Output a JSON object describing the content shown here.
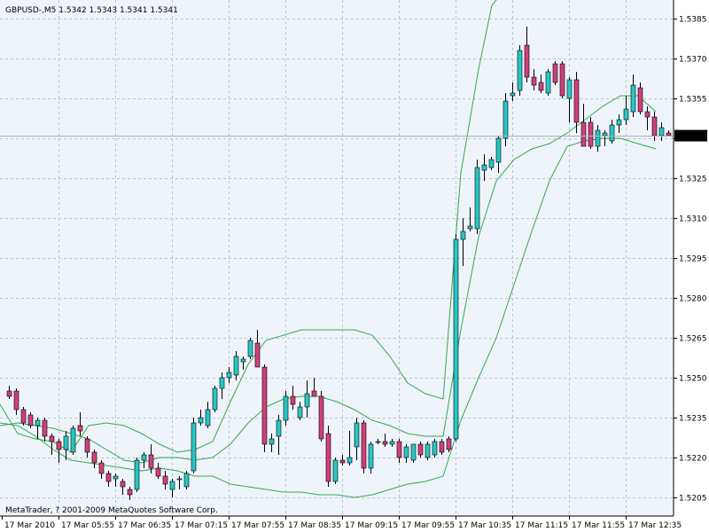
{
  "header": {
    "symbol_label": "GBPUSD-,M5  1.5342 1.5343 1.5341 1.5341"
  },
  "footer": {
    "copyright": "MetaTrader, ? 2001-2009 MetaQuotes Software Corp."
  },
  "colors": {
    "background": "#eef4fa",
    "grid": "#b9c4cf",
    "bull_body": "#28c6c6",
    "bear_body": "#d0407a",
    "band": "#37a84e",
    "price_line": "#a9b4bf",
    "price_tag_bg": "#000000",
    "price_tag_text": "#ffffff"
  },
  "chart_data": {
    "type": "candlestick",
    "title": "",
    "ylim": [
      1.5198,
      1.5392
    ],
    "y_ticks": [
      "1.5385",
      "1.5370",
      "1.5355",
      "1.5340",
      "1.5325",
      "1.5310",
      "1.5295",
      "1.5280",
      "1.5265",
      "1.5250",
      "1.5235",
      "1.5220",
      "1.5205"
    ],
    "current_price": "1.5341",
    "x_ticks": [
      "17 Mar 2010",
      "17 Mar 05:55",
      "17 Mar 06:35",
      "17 Mar 07:15",
      "17 Mar 07:55",
      "17 Mar 08:35",
      "17 Mar 09:15",
      "17 Mar 09:55",
      "17 Mar 10:35",
      "17 Mar 11:15",
      "17 Mar 11:55",
      "17 Mar 12:35"
    ],
    "candles": [
      {
        "o": 1.5245,
        "h": 1.5247,
        "l": 1.5242,
        "c": 1.5243
      },
      {
        "o": 1.5245,
        "h": 1.5246,
        "l": 1.5236,
        "c": 1.5238
      },
      {
        "o": 1.5238,
        "h": 1.5239,
        "l": 1.5232,
        "c": 1.5233
      },
      {
        "o": 1.5236,
        "h": 1.5237,
        "l": 1.5231,
        "c": 1.5232
      },
      {
        "o": 1.5232,
        "h": 1.5235,
        "l": 1.5227,
        "c": 1.5234
      },
      {
        "o": 1.5234,
        "h": 1.5235,
        "l": 1.5226,
        "c": 1.5228
      },
      {
        "o": 1.5228,
        "h": 1.5229,
        "l": 1.5221,
        "c": 1.5226
      },
      {
        "o": 1.5226,
        "h": 1.5227,
        "l": 1.5218,
        "c": 1.5223
      },
      {
        "o": 1.5223,
        "h": 1.523,
        "l": 1.5219,
        "c": 1.5228
      },
      {
        "o": 1.5222,
        "h": 1.5232,
        "l": 1.5221,
        "c": 1.5231
      },
      {
        "o": 1.5232,
        "h": 1.5237,
        "l": 1.5228,
        "c": 1.523
      },
      {
        "o": 1.5227,
        "h": 1.5228,
        "l": 1.522,
        "c": 1.5222
      },
      {
        "o": 1.5222,
        "h": 1.5223,
        "l": 1.5216,
        "c": 1.5218
      },
      {
        "o": 1.5218,
        "h": 1.5219,
        "l": 1.5212,
        "c": 1.5214
      },
      {
        "o": 1.5214,
        "h": 1.5215,
        "l": 1.5209,
        "c": 1.5211
      },
      {
        "o": 1.5212,
        "h": 1.5214,
        "l": 1.5209,
        "c": 1.5213
      },
      {
        "o": 1.5211,
        "h": 1.5212,
        "l": 1.5206,
        "c": 1.5209
      },
      {
        "o": 1.5208,
        "h": 1.5209,
        "l": 1.5204,
        "c": 1.5206
      },
      {
        "o": 1.5208,
        "h": 1.522,
        "l": 1.5207,
        "c": 1.5219
      },
      {
        "o": 1.5219,
        "h": 1.5222,
        "l": 1.5216,
        "c": 1.5221
      },
      {
        "o": 1.5221,
        "h": 1.5225,
        "l": 1.5214,
        "c": 1.5216
      },
      {
        "o": 1.5216,
        "h": 1.5218,
        "l": 1.5212,
        "c": 1.5213
      },
      {
        "o": 1.5213,
        "h": 1.5215,
        "l": 1.5208,
        "c": 1.521
      },
      {
        "o": 1.5208,
        "h": 1.5212,
        "l": 1.5205,
        "c": 1.5211
      },
      {
        "o": 1.5212,
        "h": 1.5213,
        "l": 1.5208,
        "c": 1.5212
      },
      {
        "o": 1.5209,
        "h": 1.5215,
        "l": 1.5208,
        "c": 1.5214
      },
      {
        "o": 1.5215,
        "h": 1.5235,
        "l": 1.5214,
        "c": 1.5233
      },
      {
        "o": 1.5233,
        "h": 1.5238,
        "l": 1.5232,
        "c": 1.5235
      },
      {
        "o": 1.5232,
        "h": 1.5241,
        "l": 1.5231,
        "c": 1.5238
      },
      {
        "o": 1.5238,
        "h": 1.5247,
        "l": 1.5237,
        "c": 1.5246
      },
      {
        "o": 1.5246,
        "h": 1.5252,
        "l": 1.5242,
        "c": 1.525
      },
      {
        "o": 1.525,
        "h": 1.5254,
        "l": 1.5248,
        "c": 1.5252
      },
      {
        "o": 1.5251,
        "h": 1.526,
        "l": 1.5249,
        "c": 1.5258
      },
      {
        "o": 1.5256,
        "h": 1.5258,
        "l": 1.5253,
        "c": 1.5257
      },
      {
        "o": 1.5258,
        "h": 1.5265,
        "l": 1.5257,
        "c": 1.5264
      },
      {
        "o": 1.5263,
        "h": 1.5268,
        "l": 1.5254,
        "c": 1.5254
      },
      {
        "o": 1.5254,
        "h": 1.5255,
        "l": 1.5222,
        "c": 1.5225
      },
      {
        "o": 1.5225,
        "h": 1.5229,
        "l": 1.5222,
        "c": 1.5227
      },
      {
        "o": 1.5228,
        "h": 1.5236,
        "l": 1.5221,
        "c": 1.5234
      },
      {
        "o": 1.5234,
        "h": 1.5245,
        "l": 1.5232,
        "c": 1.5243
      },
      {
        "o": 1.5243,
        "h": 1.5247,
        "l": 1.5238,
        "c": 1.524
      },
      {
        "o": 1.5235,
        "h": 1.5241,
        "l": 1.5234,
        "c": 1.5239
      },
      {
        "o": 1.5239,
        "h": 1.5249,
        "l": 1.5235,
        "c": 1.5244
      },
      {
        "o": 1.5245,
        "h": 1.525,
        "l": 1.5243,
        "c": 1.5243
      },
      {
        "o": 1.5243,
        "h": 1.5245,
        "l": 1.5226,
        "c": 1.5227
      },
      {
        "o": 1.5229,
        "h": 1.5232,
        "l": 1.5209,
        "c": 1.5211
      },
      {
        "o": 1.5211,
        "h": 1.522,
        "l": 1.521,
        "c": 1.5219
      },
      {
        "o": 1.5219,
        "h": 1.5221,
        "l": 1.5217,
        "c": 1.5218
      },
      {
        "o": 1.5218,
        "h": 1.523,
        "l": 1.5217,
        "c": 1.522
      },
      {
        "o": 1.5224,
        "h": 1.5235,
        "l": 1.5219,
        "c": 1.5233
      },
      {
        "o": 1.5233,
        "h": 1.5234,
        "l": 1.5214,
        "c": 1.5216
      },
      {
        "o": 1.5216,
        "h": 1.5226,
        "l": 1.5214,
        "c": 1.5225
      },
      {
        "o": 1.5226,
        "h": 1.5227,
        "l": 1.5225,
        "c": 1.5226
      },
      {
        "o": 1.5226,
        "h": 1.5229,
        "l": 1.5224,
        "c": 1.5225
      },
      {
        "o": 1.5225,
        "h": 1.5227,
        "l": 1.5224,
        "c": 1.5226
      },
      {
        "o": 1.5226,
        "h": 1.5227,
        "l": 1.5218,
        "c": 1.522
      },
      {
        "o": 1.522,
        "h": 1.5225,
        "l": 1.5218,
        "c": 1.5224
      },
      {
        "o": 1.5219,
        "h": 1.5225,
        "l": 1.5218,
        "c": 1.5225
      },
      {
        "o": 1.5225,
        "h": 1.5226,
        "l": 1.522,
        "c": 1.5221
      },
      {
        "o": 1.522,
        "h": 1.5226,
        "l": 1.5219,
        "c": 1.5225
      },
      {
        "o": 1.5221,
        "h": 1.5227,
        "l": 1.522,
        "c": 1.5226
      },
      {
        "o": 1.5226,
        "h": 1.5227,
        "l": 1.5221,
        "c": 1.5222
      },
      {
        "o": 1.5227,
        "h": 1.5228,
        "l": 1.5222,
        "c": 1.5223
      },
      {
        "o": 1.5227,
        "h": 1.5304,
        "l": 1.5226,
        "c": 1.5302
      },
      {
        "o": 1.5302,
        "h": 1.531,
        "l": 1.5292,
        "c": 1.5305
      },
      {
        "o": 1.5306,
        "h": 1.5314,
        "l": 1.5305,
        "c": 1.5307
      },
      {
        "o": 1.5306,
        "h": 1.5332,
        "l": 1.5304,
        "c": 1.5329
      },
      {
        "o": 1.5328,
        "h": 1.5334,
        "l": 1.5324,
        "c": 1.533
      },
      {
        "o": 1.5329,
        "h": 1.5333,
        "l": 1.5328,
        "c": 1.5332
      },
      {
        "o": 1.5331,
        "h": 1.5341,
        "l": 1.5327,
        "c": 1.534
      },
      {
        "o": 1.534,
        "h": 1.5357,
        "l": 1.5337,
        "c": 1.5354
      },
      {
        "o": 1.5356,
        "h": 1.5361,
        "l": 1.5354,
        "c": 1.5357
      },
      {
        "o": 1.5358,
        "h": 1.5375,
        "l": 1.5356,
        "c": 1.5373
      },
      {
        "o": 1.5375,
        "h": 1.5382,
        "l": 1.5361,
        "c": 1.5363
      },
      {
        "o": 1.5363,
        "h": 1.5366,
        "l": 1.5358,
        "c": 1.536
      },
      {
        "o": 1.5361,
        "h": 1.5364,
        "l": 1.5357,
        "c": 1.5358
      },
      {
        "o": 1.5357,
        "h": 1.5366,
        "l": 1.5356,
        "c": 1.5365
      },
      {
        "o": 1.5368,
        "h": 1.5369,
        "l": 1.536,
        "c": 1.5361
      },
      {
        "o": 1.5368,
        "h": 1.5369,
        "l": 1.5355,
        "c": 1.5356
      },
      {
        "o": 1.5355,
        "h": 1.5363,
        "l": 1.5346,
        "c": 1.5362
      },
      {
        "o": 1.5362,
        "h": 1.5365,
        "l": 1.5342,
        "c": 1.5346
      },
      {
        "o": 1.5346,
        "h": 1.5353,
        "l": 1.5338,
        "c": 1.5337
      },
      {
        "o": 1.5346,
        "h": 1.5348,
        "l": 1.5336,
        "c": 1.5337
      },
      {
        "o": 1.5337,
        "h": 1.5345,
        "l": 1.5335,
        "c": 1.5343
      },
      {
        "o": 1.5341,
        "h": 1.5343,
        "l": 1.5337,
        "c": 1.5342
      },
      {
        "o": 1.5339,
        "h": 1.5347,
        "l": 1.5338,
        "c": 1.5345
      },
      {
        "o": 1.5345,
        "h": 1.5349,
        "l": 1.5342,
        "c": 1.5347
      },
      {
        "o": 1.5347,
        "h": 1.5356,
        "l": 1.5345,
        "c": 1.5351
      },
      {
        "o": 1.535,
        "h": 1.5364,
        "l": 1.5348,
        "c": 1.536
      },
      {
        "o": 1.5359,
        "h": 1.5361,
        "l": 1.5349,
        "c": 1.535
      },
      {
        "o": 1.535,
        "h": 1.5352,
        "l": 1.5343,
        "c": 1.5348
      },
      {
        "o": 1.5348,
        "h": 1.535,
        "l": 1.5339,
        "c": 1.5341
      },
      {
        "o": 1.5341,
        "h": 1.5346,
        "l": 1.5339,
        "c": 1.5344
      },
      {
        "o": 1.5342,
        "h": 1.5343,
        "l": 1.5341,
        "c": 1.5341
      }
    ],
    "bands": {
      "upper": [
        [
          0,
          1.524
        ],
        [
          20,
          1.5229
        ],
        [
          40,
          1.5227
        ],
        [
          60,
          1.5226
        ],
        [
          80,
          1.5222
        ],
        [
          100,
          1.5232
        ],
        [
          120,
          1.5233
        ],
        [
          140,
          1.5232
        ],
        [
          160,
          1.5229
        ],
        [
          180,
          1.5225
        ],
        [
          200,
          1.5222
        ],
        [
          220,
          1.5223
        ],
        [
          240,
          1.5226
        ],
        [
          260,
          1.5241
        ],
        [
          280,
          1.5255
        ],
        [
          300,
          1.5264
        ],
        [
          320,
          1.5266
        ],
        [
          340,
          1.5268
        ],
        [
          360,
          1.5268
        ],
        [
          380,
          1.5268
        ],
        [
          400,
          1.5268
        ],
        [
          420,
          1.5266
        ],
        [
          440,
          1.5258
        ],
        [
          460,
          1.5248
        ],
        [
          480,
          1.5244
        ],
        [
          500,
          1.5242
        ],
        [
          520,
          1.5327
        ],
        [
          540,
          1.5366
        ],
        [
          555,
          1.539
        ],
        [
          575,
          1.5398
        ]
      ],
      "mid": [
        [
          0,
          1.5232
        ],
        [
          20,
          1.5233
        ],
        [
          40,
          1.5232
        ],
        [
          60,
          1.5231
        ],
        [
          80,
          1.5229
        ],
        [
          100,
          1.5227
        ],
        [
          120,
          1.5223
        ],
        [
          140,
          1.5219
        ],
        [
          160,
          1.5218
        ],
        [
          180,
          1.522
        ],
        [
          200,
          1.522
        ],
        [
          220,
          1.5219
        ],
        [
          240,
          1.522
        ],
        [
          260,
          1.5225
        ],
        [
          280,
          1.5233
        ],
        [
          300,
          1.5239
        ],
        [
          320,
          1.5242
        ],
        [
          340,
          1.5243
        ],
        [
          360,
          1.5243
        ],
        [
          380,
          1.5241
        ],
        [
          400,
          1.5238
        ],
        [
          420,
          1.5234
        ],
        [
          440,
          1.5232
        ],
        [
          460,
          1.5229
        ],
        [
          480,
          1.5228
        ],
        [
          500,
          1.5228
        ],
        [
          520,
          1.5268
        ],
        [
          540,
          1.5303
        ],
        [
          560,
          1.5324
        ],
        [
          580,
          1.5332
        ],
        [
          600,
          1.5336
        ],
        [
          620,
          1.5338
        ],
        [
          640,
          1.5342
        ],
        [
          660,
          1.5347
        ],
        [
          680,
          1.5352
        ],
        [
          700,
          1.5356
        ],
        [
          720,
          1.5356
        ],
        [
          740,
          1.535
        ]
      ],
      "lower": [
        [
          0,
          1.5233
        ],
        [
          20,
          1.5232
        ],
        [
          40,
          1.5228
        ],
        [
          60,
          1.5223
        ],
        [
          80,
          1.5219
        ],
        [
          100,
          1.5218
        ],
        [
          120,
          1.5217
        ],
        [
          140,
          1.5216
        ],
        [
          160,
          1.5215
        ],
        [
          180,
          1.5216
        ],
        [
          200,
          1.5215
        ],
        [
          220,
          1.5213
        ],
        [
          240,
          1.5213
        ],
        [
          260,
          1.521
        ],
        [
          280,
          1.5209
        ],
        [
          300,
          1.5208
        ],
        [
          320,
          1.5207
        ],
        [
          340,
          1.5207
        ],
        [
          360,
          1.5206
        ],
        [
          380,
          1.5206
        ],
        [
          400,
          1.5205
        ],
        [
          420,
          1.5206
        ],
        [
          440,
          1.5208
        ],
        [
          460,
          1.521
        ],
        [
          480,
          1.5211
        ],
        [
          500,
          1.5213
        ],
        [
          520,
          1.5234
        ],
        [
          540,
          1.525
        ],
        [
          560,
          1.5265
        ],
        [
          580,
          1.5285
        ],
        [
          600,
          1.5305
        ],
        [
          620,
          1.5324
        ],
        [
          640,
          1.5337
        ],
        [
          660,
          1.5339
        ],
        [
          680,
          1.534
        ],
        [
          700,
          1.534
        ],
        [
          720,
          1.5338
        ],
        [
          740,
          1.5336
        ]
      ]
    }
  }
}
